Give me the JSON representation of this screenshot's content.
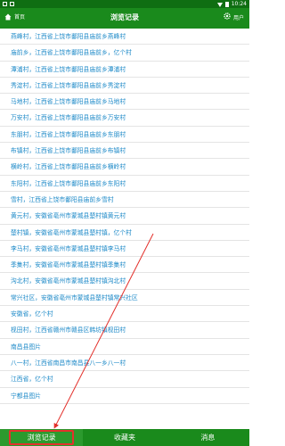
{
  "status_bar": {
    "time": "10:24"
  },
  "header": {
    "home_label": "首页",
    "title": "浏览记录",
    "user_label": "用户"
  },
  "history": [
    "燕峰村，江西省上饶市鄱阳县庙前乡燕峰村",
    "庙前乡，江西省上饶市鄱阳县庙前乡，亿个村",
    "潭浦村，江西省上饶市鄱阳县庙前乡潭浦村",
    "秀淀村，江西省上饶市鄱阳县庙前乡秀淀村",
    "马地村，江西省上饶市鄱阳县庙前乡马地村",
    "万安村，江西省上饶市鄱阳县庙前乡万安村",
    "东朋村，江西省上饶市鄱阳县庙前乡东朋村",
    "布镇村，江西省上饶市鄱阳县庙前乡布镇村",
    "横岭村，江西省上饶市鄱阳县庙前乡横岭村",
    "东阳村，江西省上饶市鄱阳县庙前乡东阳村",
    "雪村，江西省上饶市鄱阳县庙前乡雪村",
    "黄元村，安徽省亳州市蒙城县楚村镇黄元村",
    "楚村镇，安徽省亳州市蒙城县楚村镇，亿个村",
    "李马村，安徽省亳州市蒙城县楚村镇李马村",
    "季集村，安徽省亳州市蒙城县楚村镇季集村",
    "沟北村，安徽省亳州市蒙城县楚村镇沟北村",
    "常兴社区，安徽省亳州市蒙城县楚村镇常兴社区",
    "安徽省，亿个村",
    "枧田村，江西省赣州市赣县区韩坊镇枧田村",
    "南昌县图片",
    "八一村，江西省南昌市南昌县八一乡八一村",
    "江西省，亿个村",
    "宁都县图片"
  ],
  "tabs": {
    "history": "浏览记录",
    "favorites": "收藏夹",
    "messages": "消息"
  },
  "colors": {
    "header": "#1a8a1c",
    "status_bar": "#0f6e12",
    "link": "#1e8ac8",
    "highlight": "#e3312c"
  }
}
